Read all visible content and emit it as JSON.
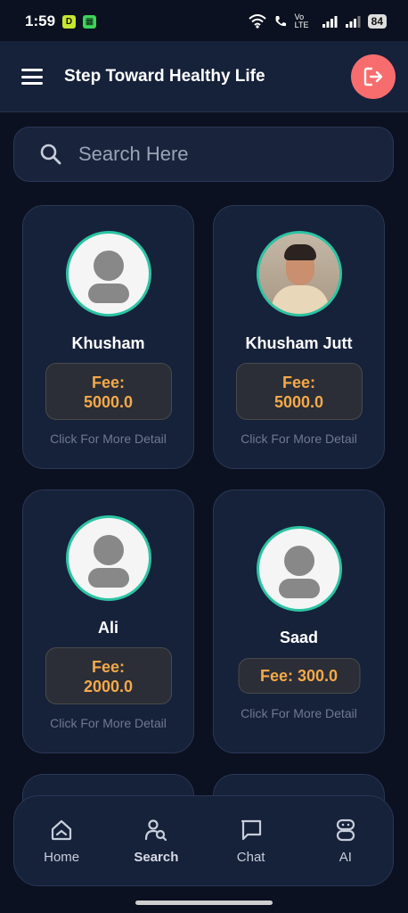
{
  "status_bar": {
    "time": "1:59",
    "battery": "84",
    "network": "Vo LTE"
  },
  "app_bar": {
    "title": "Step Toward Healthy Life"
  },
  "search": {
    "placeholder": "Search Here"
  },
  "doctors": [
    {
      "name": "Khusham",
      "fee_label": "Fee:",
      "fee": "5000.0",
      "detail": "Click For More Detail",
      "avatar": "placeholder-avatar"
    },
    {
      "name": "Khusham Jutt",
      "fee_label": "Fee:",
      "fee": "5000.0",
      "detail": "Click For More Detail",
      "avatar": "photo"
    },
    {
      "name": "Ali",
      "fee_label": "Fee:",
      "fee": "2000.0",
      "detail": "Click For More Detail",
      "avatar": "placeholder-avatar"
    },
    {
      "name": "Saad",
      "fee_text": "Fee: 300.0",
      "detail": "Click For More Detail",
      "avatar": "placeholder-avatar"
    }
  ],
  "bottom_nav": [
    {
      "label": "Home",
      "icon": "home-icon"
    },
    {
      "label": "Search",
      "icon": "search-person-icon",
      "active": true
    },
    {
      "label": "Chat",
      "icon": "chat-icon"
    },
    {
      "label": "AI",
      "icon": "robot-icon"
    }
  ],
  "colors": {
    "accent": "#2cc4a3",
    "fee_text": "#f5a94a",
    "logout": "#f76d6d",
    "card_bg": "#16213a"
  }
}
